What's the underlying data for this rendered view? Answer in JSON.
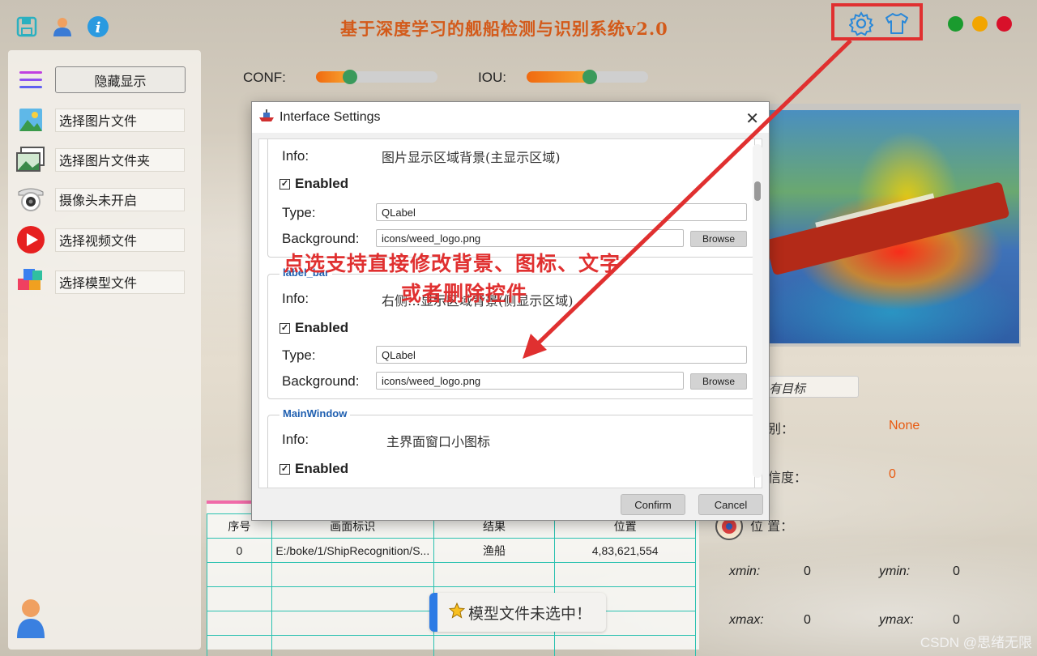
{
  "title": "基于深度学习的舰船检测与识别系统v2.0",
  "colors": {
    "accent": "#e03030",
    "title": "#d35a1a",
    "table_border": "#2ac1b0"
  },
  "top_icons": [
    "save-icon",
    "user-icon",
    "info-icon"
  ],
  "settings_icons": [
    "gear-icon",
    "tshirt-icon"
  ],
  "window_controls": [
    "#1a9b2e",
    "#f2a500",
    "#d8102a"
  ],
  "sidebar": {
    "toggle_label": "隐藏显示",
    "items": [
      {
        "label": "选择图片文件",
        "icon": "image-icon"
      },
      {
        "label": "选择图片文件夹",
        "icon": "folder-images-icon"
      },
      {
        "label": "摄像头未开启",
        "icon": "camera-icon"
      },
      {
        "label": "选择视频文件",
        "icon": "video-icon"
      },
      {
        "label": "选择模型文件",
        "icon": "model-cube-icon"
      }
    ]
  },
  "params": {
    "conf_label": "CONF:",
    "conf_value": 0.28,
    "iou_label": "IOU:",
    "iou_value": 0.52
  },
  "result": {
    "target_placeholder": "有目标",
    "class_label": "别：",
    "class_value": "None",
    "conf_label": "信度：",
    "conf_value": "0",
    "pos_label": "位  置：",
    "xmin_label": "xmin:",
    "xmin": "0",
    "ymin_label": "ymin:",
    "ymin": "0",
    "xmax_label": "xmax:",
    "xmax": "0",
    "ymax_label": "ymax:",
    "ymax": "0"
  },
  "table": {
    "headers": [
      "序号",
      "画面标识",
      "结果",
      "位置"
    ],
    "rows": [
      [
        "0",
        "E:/boke/1/ShipRecognition/S...",
        "渔船",
        "4,83,621,554"
      ]
    ]
  },
  "toast": "模型文件未选中！",
  "dialog": {
    "title": "Interface Settings",
    "info_label": "Info:",
    "enabled_label": "Enabled",
    "type_label": "Type:",
    "bg_label": "Background:",
    "browse": "Browse",
    "groups": [
      {
        "name": "",
        "info": "图片显示区域背景(主显示区域)",
        "type": "QLabel",
        "bg": "icons/weed_logo.png"
      },
      {
        "name": "label_bar",
        "info": "右侧…显示区域背景(侧显示区域)",
        "type": "QLabel",
        "bg": "icons/weed_logo.png"
      },
      {
        "name": "MainWindow",
        "info": "主界面窗口小图标"
      }
    ],
    "confirm": "Confirm",
    "cancel": "Cancel"
  },
  "annotation": {
    "line1": "点选支持直接修改背景、图标、文字",
    "line2": "或者删除控件"
  },
  "watermark": "CSDN @思绪无限"
}
